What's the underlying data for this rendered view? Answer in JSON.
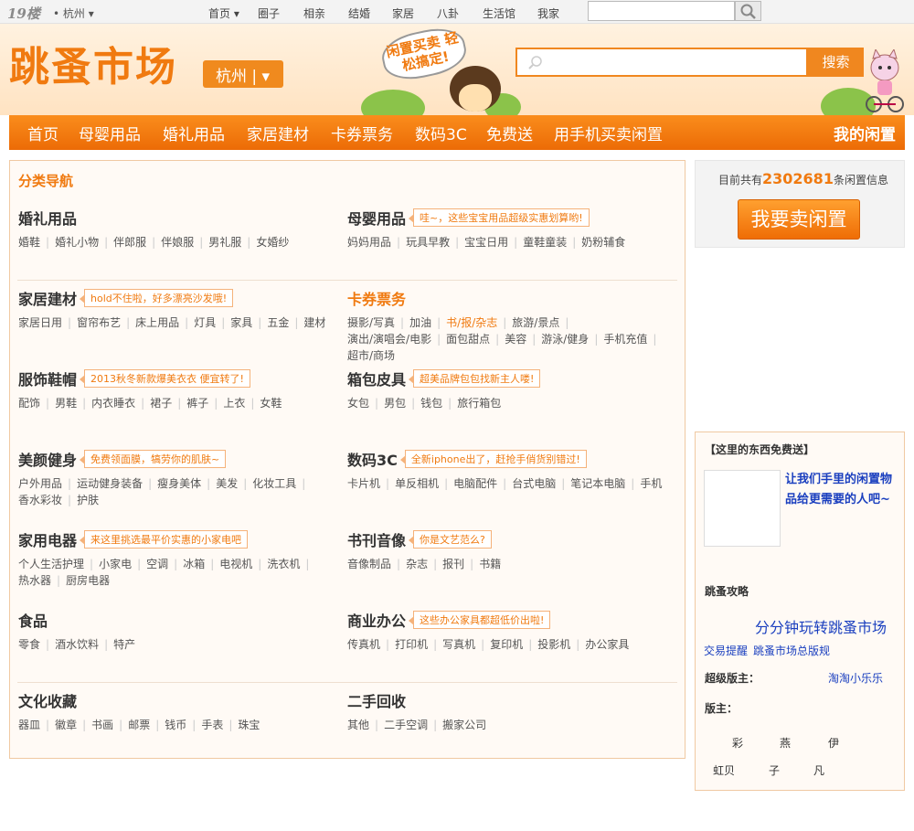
{
  "topbar": {
    "logo": "19楼",
    "city": "• 杭州 ▾",
    "nav": [
      "首页 ▾",
      "圈子",
      "相亲",
      "结婚",
      "家居",
      "八卦",
      "生活馆",
      "我家"
    ]
  },
  "header": {
    "title": "跳蚤市场",
    "city_label": "杭州 | ▾",
    "bubble_text": "闲置买卖 轻松搞定!",
    "search_placeholder": "",
    "search_button": "搜索"
  },
  "mainnav": {
    "items": [
      "首页",
      "母婴用品",
      "婚礼用品",
      "家居建材",
      "卡券票务",
      "数码3C",
      "免费送",
      "用手机买卖闲置"
    ],
    "right_link": "我的闲置"
  },
  "categories": {
    "title": "分类导航",
    "items": [
      {
        "name": "婚礼用品",
        "tip": "",
        "subs": [
          "婚鞋",
          "婚礼小物",
          "伴郎服",
          "伴娘服",
          "男礼服",
          "女婚纱"
        ]
      },
      {
        "name": "母婴用品",
        "tip": "哇~，这些宝宝用品超级实惠划算哟!",
        "subs": [
          "妈妈用品",
          "玩具早教",
          "宝宝日用",
          "童鞋童装",
          "奶粉辅食"
        ]
      },
      {
        "name": "家居建材",
        "tip": "hold不住啦，好多漂亮沙发哦!",
        "subs": [
          "家居日用",
          "窗帘布艺",
          "床上用品",
          "灯具",
          "家具",
          "五金",
          "建材"
        ]
      },
      {
        "name": "卡券票务",
        "tip": "",
        "subs": [
          "摄影/写真",
          "加油",
          "书/报/杂志",
          "旅游/景点",
          "演出/演唱会/电影",
          "面包甜点",
          "美容",
          "游泳/健身",
          "手机充值",
          "超市/商场"
        ]
      },
      {
        "name": "服饰鞋帽",
        "tip": "2013秋冬新款爆美衣衣 便宜转了!",
        "subs": [
          "配饰",
          "男鞋",
          "内衣睡衣",
          "裙子",
          "裤子",
          "上衣",
          "女鞋"
        ]
      },
      {
        "name": "箱包皮具",
        "tip": "超美品牌包包找新主人喽!",
        "subs": [
          "女包",
          "男包",
          "钱包",
          "旅行箱包"
        ]
      },
      {
        "name": "美颜健身",
        "tip": "免费领面膜，犒劳你的肌肤~",
        "subs": [
          "户外用品",
          "运动健身装备",
          "瘦身美体",
          "美发",
          "化妆工具",
          "香水彩妆",
          "护肤"
        ]
      },
      {
        "name": "数码3C",
        "tip": "全新iphone出了，赶抢手俏货别错过!",
        "subs": [
          "卡片机",
          "单反相机",
          "电脑配件",
          "台式电脑",
          "笔记本电脑",
          "手机"
        ]
      },
      {
        "name": "家用电器",
        "tip": "来这里挑选最平价实惠的小家电吧",
        "subs": [
          "个人生活护理",
          "小家电",
          "空调",
          "冰箱",
          "电视机",
          "洗衣机",
          "热水器",
          "厨房电器"
        ]
      },
      {
        "name": "书刊音像",
        "tip": "你是文艺范么?",
        "subs": [
          "音像制品",
          "杂志",
          "报刊",
          "书籍"
        ]
      },
      {
        "name": "食品",
        "tip": "",
        "subs": [
          "零食",
          "酒水饮料",
          "特产"
        ]
      },
      {
        "name": "商业办公",
        "tip": "这些办公家具都超低价出啦!",
        "subs": [
          "传真机",
          "打印机",
          "写真机",
          "复印机",
          "投影机",
          "办公家具"
        ]
      },
      {
        "name": "文化收藏",
        "tip": "",
        "subs": [
          "器皿",
          "徽章",
          "书画",
          "邮票",
          "钱币",
          "手表",
          "珠宝"
        ]
      },
      {
        "name": "二手回收",
        "tip": "",
        "subs": [
          "其他",
          "二手空调",
          "搬家公司"
        ]
      }
    ]
  },
  "sidebar": {
    "count_prefix": "目前共有",
    "count": "2302681",
    "count_suffix": "条闲置信息",
    "sell_button": "我要卖闲置",
    "free_title": "【这里的东西免费送】",
    "free_link": "让我们手里的闲置物品给更需要的人吧~",
    "guide_title": "跳蚤攻略",
    "guide_main": "分分钟玩转跳蚤市场",
    "guide_link1": "交易提醒",
    "guide_link2": "跳蚤市场总版规",
    "super_mod_label": "超级版主：",
    "super_mod_name": "淘淘小乐乐",
    "mod_label": "版主：",
    "mods": [
      "彩",
      "燕",
      "伊",
      "虹贝",
      "子",
      "凡"
    ]
  },
  "colors": {
    "brand_orange": "#f07a10",
    "link_blue": "#1a3fbf",
    "nav_gradient_top": "#fa8d1c",
    "nav_gradient_bottom": "#ec6b06"
  }
}
